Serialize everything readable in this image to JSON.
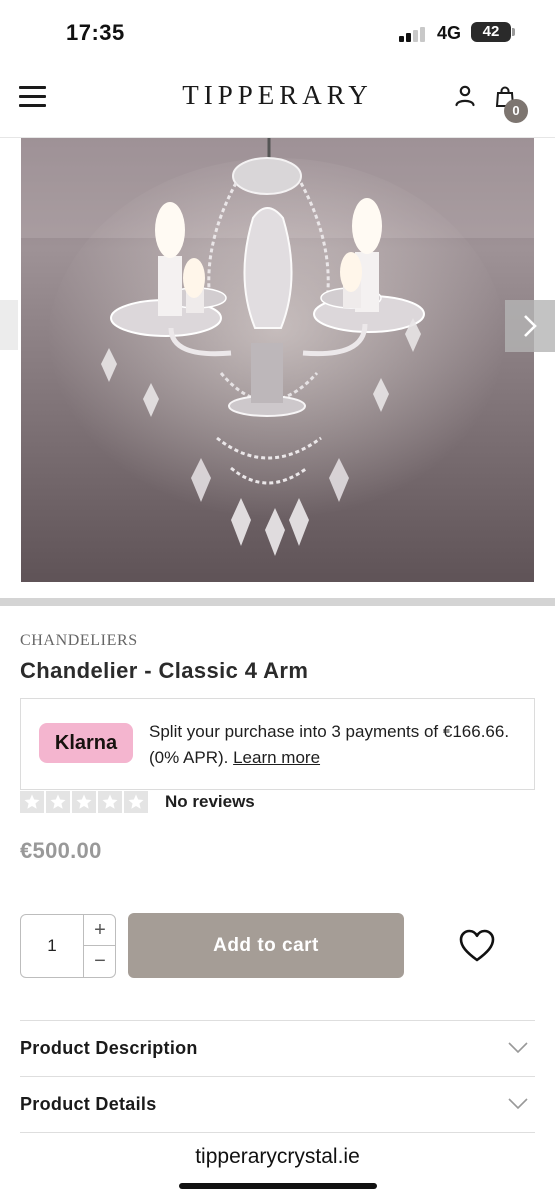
{
  "status_bar": {
    "time": "17:35",
    "network": "4G",
    "battery": "42"
  },
  "header": {
    "logo": "TIPPERARY",
    "menu_icon": "hamburger-menu-icon",
    "account_icon": "user-icon",
    "cart_icon": "shopping-bag-icon",
    "cart_count": "0"
  },
  "gallery": {
    "image": "chandelier-photo",
    "next_icon": "chevron-right-icon"
  },
  "product": {
    "category": "CHANDELIERS",
    "title": "Chandelier - Classic 4 Arm",
    "price": "€500.00"
  },
  "klarna": {
    "badge": "Klarna",
    "text": "Split your purchase into 3 payments of €166.66. (0% APR).",
    "link": "Learn more",
    "badge_color": "#f4b5cf"
  },
  "rating": {
    "stars_filled": 0,
    "stars_total": 5,
    "label": "No reviews"
  },
  "purchase": {
    "quantity": "1",
    "plus": "+",
    "minus": "−",
    "add_to_cart": "Add to cart",
    "button_color": "#a59d96",
    "wishlist_icon": "heart-icon"
  },
  "accordions": [
    {
      "label": "Product Description",
      "icon": "chevron-down-icon"
    },
    {
      "label": "Product Details",
      "icon": "chevron-down-icon"
    }
  ],
  "browser": {
    "url": "tipperarycrystal.ie"
  }
}
